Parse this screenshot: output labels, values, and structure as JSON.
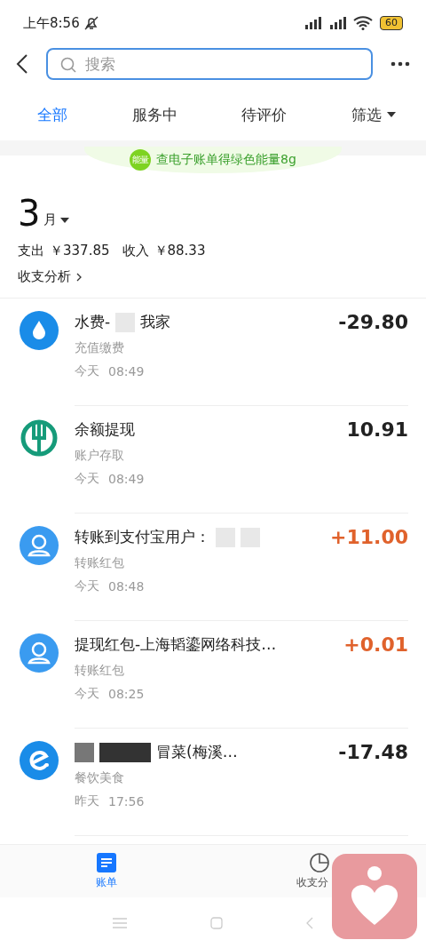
{
  "status_bar": {
    "time": "上午8:56",
    "battery": "60"
  },
  "header": {
    "search": {
      "placeholder": "搜索"
    }
  },
  "tabs": [
    {
      "label": "全部",
      "selected": true
    },
    {
      "label": "服务中",
      "selected": false
    },
    {
      "label": "待评价",
      "selected": false
    },
    {
      "label": "筛选",
      "selected": false,
      "kind": "dropdown"
    }
  ],
  "banner": {
    "badge": "能量",
    "text": "查电子账单得绿色能量8g"
  },
  "summary": {
    "month": "3",
    "month_unit": "月",
    "expense_label": "支出",
    "expense": "￥337.85",
    "income_label": "收入",
    "income": "￥88.33",
    "analysis_link": "收支分析"
  },
  "transactions": [
    {
      "kind": "water",
      "title": [
        {
          "kind": "text",
          "text": "水费-"
        },
        {
          "kind": "redaction"
        },
        {
          "kind": "text",
          "text": "我家"
        }
      ],
      "category": "充值缴费",
      "day": "今天",
      "time": "08:49",
      "amount": "-29.80",
      "income": false
    },
    {
      "kind": "bank",
      "title": [
        {
          "kind": "text",
          "text": "余额提现"
        }
      ],
      "category": "账户存取",
      "day": "今天",
      "time": "08:49",
      "amount": "10.91",
      "income": false
    },
    {
      "kind": "transfer",
      "title": [
        {
          "kind": "text",
          "text": "转账到支付宝用户："
        },
        {
          "kind": "redaction"
        },
        {
          "kind": "redaction"
        }
      ],
      "category": "转账红包",
      "day": "今天",
      "time": "08:48",
      "amount": "+11.00",
      "income": true
    },
    {
      "kind": "transfer",
      "title": [
        {
          "kind": "text",
          "text": "提现红包-上海韬鎏网络科技…"
        }
      ],
      "category": "转账红包",
      "day": "今天",
      "time": "08:25",
      "amount": "+0.01",
      "income": true
    },
    {
      "kind": "food",
      "title": [
        {
          "kind": "redaction"
        },
        {
          "kind": "redaction"
        },
        {
          "kind": "text",
          "text": "冒菜(梅溪…"
        }
      ],
      "category": "餐饮美食",
      "day": "昨天",
      "time": "17:56",
      "amount": "-17.48",
      "income": false
    }
  ],
  "bottom_tabs": [
    {
      "label": "账单",
      "selected": true,
      "kind": "list"
    },
    {
      "label": "收支分",
      "selected": false,
      "kind": "pie"
    }
  ]
}
